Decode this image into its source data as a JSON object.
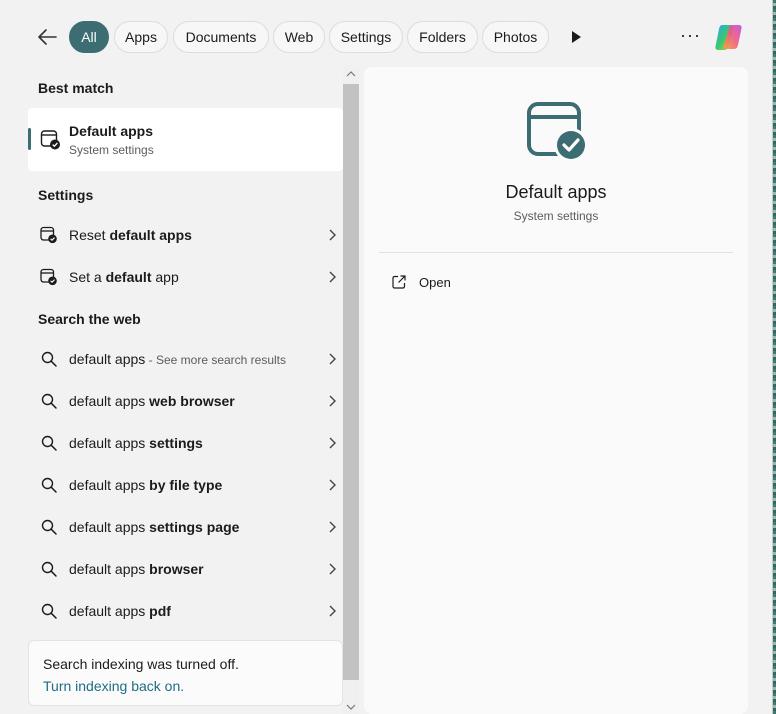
{
  "filters": {
    "tabs": [
      {
        "label": "All",
        "active": true
      },
      {
        "label": "Apps"
      },
      {
        "label": "Documents"
      },
      {
        "label": "Web"
      },
      {
        "label": "Settings"
      },
      {
        "label": "Folders"
      },
      {
        "label": "Photos"
      }
    ],
    "icons": {
      "back": "back-arrow-icon",
      "play": "play-icon",
      "more": "more-icon",
      "copilot": "copilot-icon"
    },
    "more_glyph": "···"
  },
  "results": {
    "best_match_label": "Best match",
    "best_match": {
      "title": "Default apps",
      "subtitle": "System settings",
      "icon": "default-apps-icon"
    },
    "settings_label": "Settings",
    "settings_items": [
      {
        "prefix": "Reset ",
        "bold": "default apps",
        "suffix": ""
      },
      {
        "prefix": "Set a ",
        "bold": "default",
        "suffix": " app"
      }
    ],
    "web_label": "Search the web",
    "web_items": [
      {
        "prefix": "default apps",
        "bold": "",
        "muted": " - See more search results"
      },
      {
        "prefix": "default apps ",
        "bold": "web browser",
        "muted": ""
      },
      {
        "prefix": "default apps ",
        "bold": "settings",
        "muted": ""
      },
      {
        "prefix": "default apps ",
        "bold": "by file type",
        "muted": ""
      },
      {
        "prefix": "default apps ",
        "bold": "settings page",
        "muted": ""
      },
      {
        "prefix": "default apps ",
        "bold": "browser",
        "muted": ""
      },
      {
        "prefix": "default apps ",
        "bold": "pdf",
        "muted": ""
      }
    ],
    "notice": {
      "text": "Search indexing was turned off.",
      "link": "Turn indexing back on."
    }
  },
  "preview": {
    "title": "Default apps",
    "subtitle": "System settings",
    "actions": [
      {
        "label": "Open",
        "icon": "open-external-icon"
      }
    ]
  },
  "colors": {
    "accent": "#3c6d73",
    "link": "#1f6c85"
  }
}
